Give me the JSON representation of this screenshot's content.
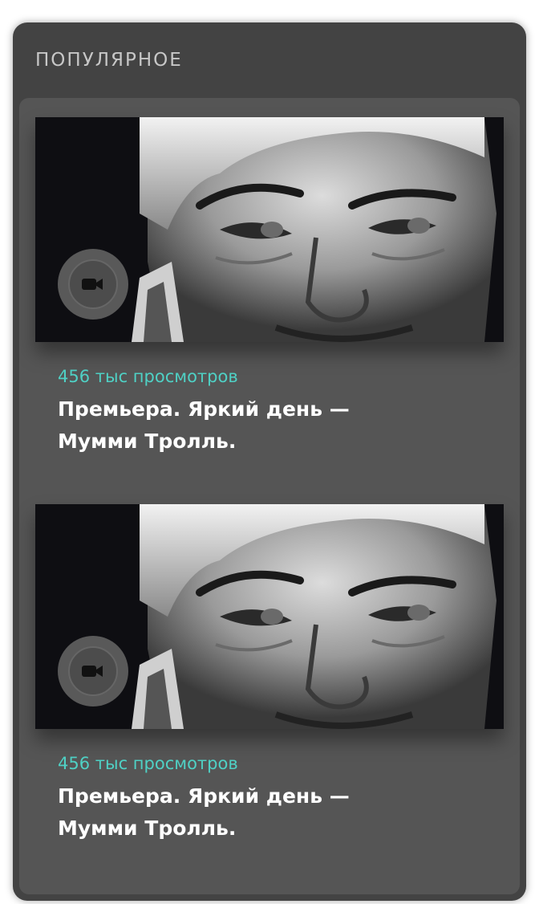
{
  "section": {
    "title": "ПОПУЛЯРНОЕ"
  },
  "cards": [
    {
      "views": "456 тыс просмотров",
      "title": "Премьера. Яркий день — Мумми Тролль.",
      "icon": "video-camera-icon"
    },
    {
      "views": "456 тыс просмотров",
      "title": "Премьера. Яркий день — Мумми Тролль.",
      "icon": "video-camera-icon"
    }
  ],
  "colors": {
    "accent": "#4fd1c5",
    "panel": "#434343",
    "card": "#555555"
  }
}
